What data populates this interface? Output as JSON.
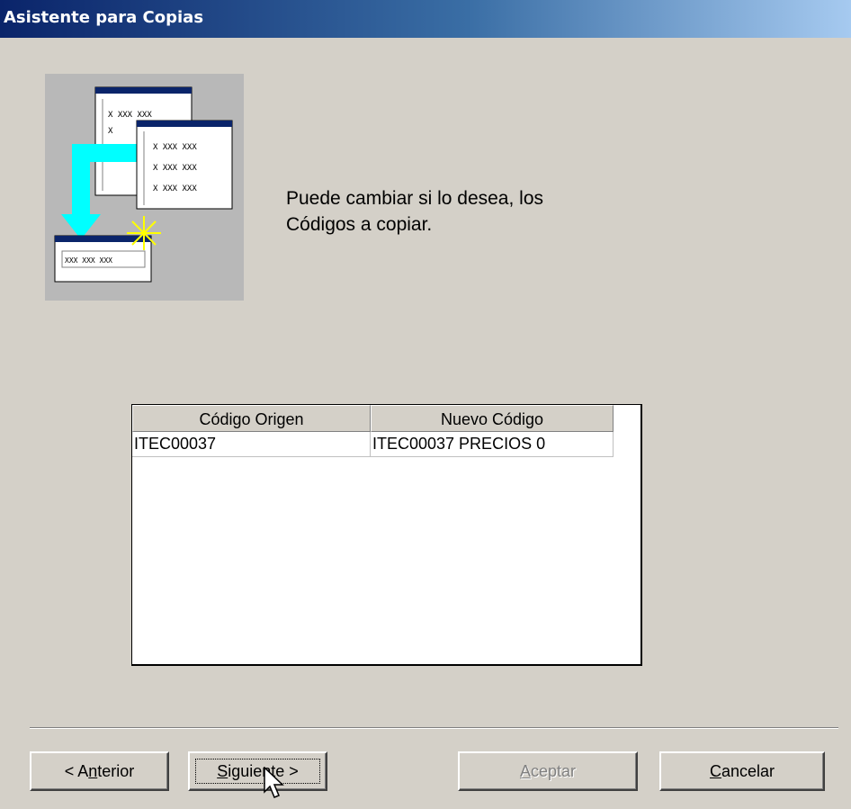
{
  "window": {
    "title": "Asistente para Copias"
  },
  "message": "Puede cambiar si lo desea, los\nCódigos a copiar.",
  "wizard_art": {
    "small_form_cell": "XXX XXX XXX"
  },
  "table": {
    "columns": [
      "Código Origen",
      "Nuevo Código"
    ],
    "rows": [
      [
        "ITEC00037",
        "ITEC00037 PRECIOS 0"
      ]
    ]
  },
  "buttons": {
    "anterior": {
      "pre": "< A",
      "acc": "n",
      "post": "terior"
    },
    "siguiente": {
      "pre": "",
      "acc": "S",
      "post": "iguiente >"
    },
    "aceptar": {
      "pre": "",
      "acc": "A",
      "post": "ceptar",
      "disabled": true
    },
    "cancelar": {
      "pre": "",
      "acc": "C",
      "post": "ancelar"
    }
  },
  "colors": {
    "titlebar_start": "#0a246a",
    "titlebar_end": "#a6caf0",
    "dialog_bg": "#d4d0c8",
    "arrow_cyan": "#00ffff"
  }
}
